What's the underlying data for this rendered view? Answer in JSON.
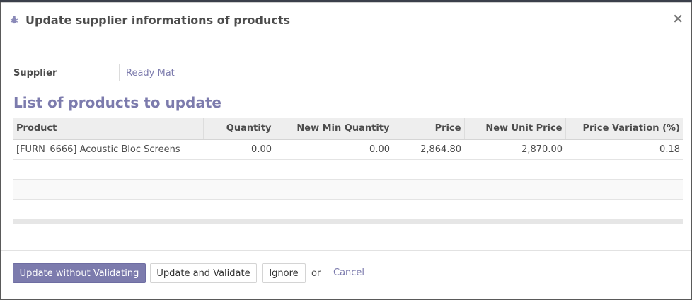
{
  "dialog": {
    "title": "Update supplier informations of products",
    "close_label": "×",
    "header_icon": "bug-icon"
  },
  "supplier": {
    "label": "Supplier",
    "value": "Ready Mat"
  },
  "products_section": {
    "title": "List of products to update",
    "columns": [
      "Product",
      "Quantity",
      "New Min Quantity",
      "Price",
      "New Unit Price",
      "Price Variation (%)"
    ],
    "rows": [
      {
        "product": "[FURN_6666] Acoustic Bloc Screens",
        "quantity": "0.00",
        "new_min_quantity": "0.00",
        "price": "2,864.80",
        "new_unit_price": "2,870.00",
        "price_variation": "0.18"
      }
    ]
  },
  "footer": {
    "update_without_validating": "Update without Validating",
    "update_and_validate": "Update and Validate",
    "ignore": "Ignore",
    "or": "or",
    "cancel": "Cancel"
  },
  "colors": {
    "accent": "#7c7bad",
    "text": "#4c4c4c",
    "header_bg": "#eeeeee"
  }
}
